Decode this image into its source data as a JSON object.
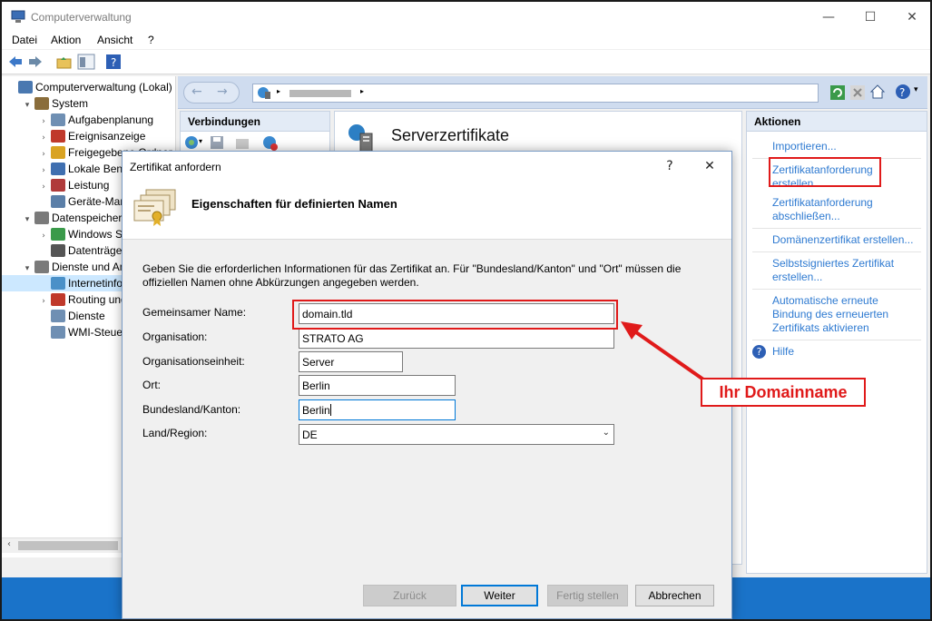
{
  "window": {
    "title": "Computerverwaltung",
    "minimize": "—",
    "maximize": "☐",
    "close": "✕"
  },
  "menu": [
    "Datei",
    "Aktion",
    "Ansicht",
    "?"
  ],
  "tree": [
    {
      "label": "Computerverwaltung (Lokal)",
      "indent": 0,
      "twist": "",
      "color": "#4a78b0"
    },
    {
      "label": "System",
      "indent": 1,
      "twist": "▾",
      "color": "#8a6d3b"
    },
    {
      "label": "Aufgabenplanung",
      "indent": 2,
      "twist": "›",
      "color": "#6f8fb3"
    },
    {
      "label": "Ereignisanzeige",
      "indent": 2,
      "twist": "›",
      "color": "#c0392b"
    },
    {
      "label": "Freigegebene Ordner",
      "indent": 2,
      "twist": "›",
      "color": "#d9a322"
    },
    {
      "label": "Lokale Benutzer",
      "indent": 2,
      "twist": "›",
      "color": "#3f6fb0"
    },
    {
      "label": "Leistung",
      "indent": 2,
      "twist": "›",
      "color": "#b03a3a"
    },
    {
      "label": "Geräte-Manager",
      "indent": 2,
      "twist": "",
      "color": "#5b7fa8"
    },
    {
      "label": "Datenspeicher",
      "indent": 1,
      "twist": "▾",
      "color": "#7a7a7a"
    },
    {
      "label": "Windows Server",
      "indent": 2,
      "twist": "›",
      "color": "#3a9a4a"
    },
    {
      "label": "Datenträgerverwaltung",
      "indent": 2,
      "twist": "",
      "color": "#555555"
    },
    {
      "label": "Dienste und Anwendungen",
      "indent": 1,
      "twist": "▾",
      "color": "#7a7a7a"
    },
    {
      "label": "Internetinformationsdienste",
      "indent": 2,
      "twist": "",
      "color": "#4a90c8",
      "selected": true
    },
    {
      "label": "Routing und RAS",
      "indent": 2,
      "twist": "›",
      "color": "#c0392b"
    },
    {
      "label": "Dienste",
      "indent": 2,
      "twist": "",
      "color": "#6f8fb3"
    },
    {
      "label": "WMI-Steuerung",
      "indent": 2,
      "twist": "",
      "color": "#6f8fb3"
    }
  ],
  "iis": {
    "connections_title": "Verbindungen",
    "main_title": "Serverzertifikate",
    "actions_title": "Aktionen",
    "actions": [
      {
        "label": "Importieren...",
        "sep_after": true
      },
      {
        "label": "Zertifikatanforderung erstellen...",
        "highlight": true
      },
      {
        "label": "Zertifikatanforderung abschließen...",
        "sep_after": true
      },
      {
        "label": "Domänenzertifikat erstellen...",
        "sep_after": true
      },
      {
        "label": "Selbstsigniertes Zertifikat erstellen...",
        "sep_after": true
      },
      {
        "label": "Automatische erneute Bindung des erneuerten Zertifikats aktivieren",
        "sep_after": true
      },
      {
        "label": "Hilfe",
        "help": true
      }
    ]
  },
  "dialog": {
    "title": "Zertifikat anfordern",
    "help": "?",
    "close": "✕",
    "heading": "Eigenschaften für definierten Namen",
    "description": "Geben Sie die erforderlichen Informationen für das Zertifikat an. Für \"Bundesland/Kanton\" und \"Ort\" müssen die offiziellen Namen ohne Abkürzungen angegeben werden.",
    "fields": [
      {
        "label": "Gemeinsamer Name:",
        "value": "domain.tld"
      },
      {
        "label": "Organisation:",
        "value": "STRATO AG"
      },
      {
        "label": "Organisationseinheit:",
        "value": "Server"
      },
      {
        "label": "Ort:",
        "value": "Berlin"
      },
      {
        "label": "Bundesland/Kanton:",
        "value": "Berlin"
      },
      {
        "label": "Land/Region:",
        "value": "DE"
      }
    ],
    "buttons": {
      "back": "Zurück",
      "next": "Weiter",
      "finish": "Fertig stellen",
      "cancel": "Abbrechen"
    }
  },
  "annotation": {
    "label": "Ihr Domainname",
    "color": "#e01a1a"
  }
}
